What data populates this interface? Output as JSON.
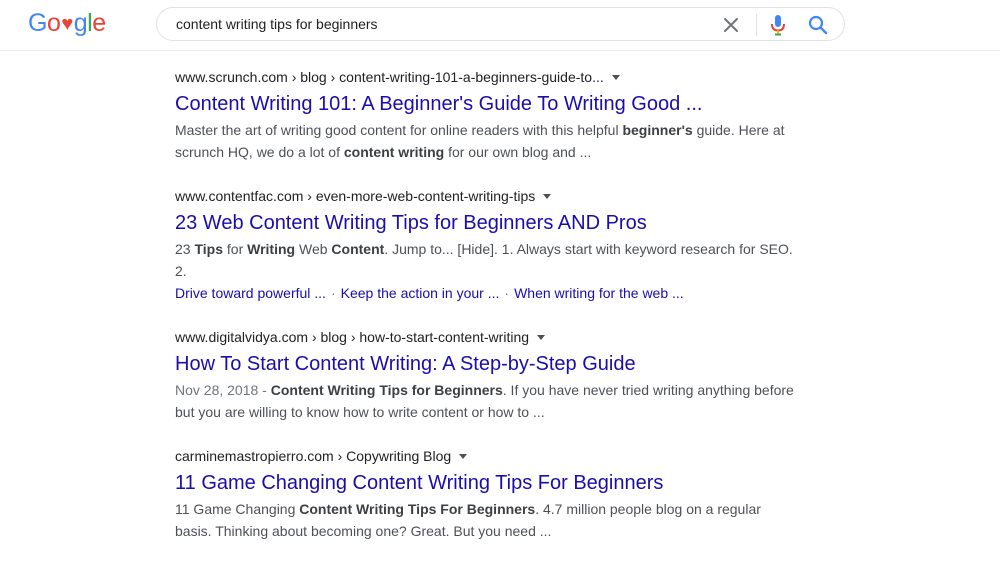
{
  "logo": {
    "letters": [
      {
        "char": "G",
        "color": "#4285F4"
      },
      {
        "char": "o",
        "color": "#EA4335"
      },
      {
        "char": "♥",
        "color": "#EA4335"
      },
      {
        "char": "g",
        "color": "#4285F4"
      },
      {
        "char": "l",
        "color": "#34A853"
      },
      {
        "char": "e",
        "color": "#EA4335"
      }
    ]
  },
  "search": {
    "query": "content writing tips for beginners",
    "icons": [
      "close-icon",
      "microphone-icon",
      "search-icon"
    ]
  },
  "colors": {
    "link": "#1a0dab",
    "snippet": "#4d5156",
    "cite": "#202124",
    "mic_blue": "#4285F4",
    "mic_red": "#EA4335",
    "search_icon": "#4285F4"
  },
  "results": [
    {
      "cite": "www.scrunch.com › blog › content-writing-101-a-beginners-guide-to...",
      "title": "Content Writing 101: A Beginner's Guide To Writing Good ...",
      "snippet_parts": [
        {
          "t": "Master the art of writing good content for online readers with this helpful ",
          "b": false
        },
        {
          "t": "beginner's",
          "b": true
        },
        {
          "t": " guide. Here at scrunch HQ, we do a lot of ",
          "b": false
        },
        {
          "t": "content writing",
          "b": true
        },
        {
          "t": " for our own blog and ...",
          "b": false
        }
      ],
      "sitelinks": []
    },
    {
      "cite": "www.contentfac.com › even-more-web-content-writing-tips",
      "title": "23 Web Content Writing Tips for Beginners AND Pros",
      "snippet_parts": [
        {
          "t": "23 ",
          "b": false
        },
        {
          "t": "Tips",
          "b": true
        },
        {
          "t": " for ",
          "b": false
        },
        {
          "t": "Writing",
          "b": true
        },
        {
          "t": " Web ",
          "b": false
        },
        {
          "t": "Content",
          "b": true
        },
        {
          "t": ". Jump to... [Hide]. 1. Always start with keyword research for SEO. 2.",
          "b": false
        }
      ],
      "sitelinks": [
        "Drive toward powerful ...",
        "Keep the action in your ...",
        "When writing for the web ..."
      ]
    },
    {
      "cite": "www.digitalvidya.com › blog › how-to-start-content-writing",
      "title": "How To Start Content Writing: A Step-by-Step Guide",
      "date": "Nov 28, 2018 - ",
      "snippet_parts": [
        {
          "t": "Content Writing Tips for Beginners",
          "b": true
        },
        {
          "t": ". If you have never tried writing anything before but you are willing to know how to write content or how to ...",
          "b": false
        }
      ],
      "sitelinks": []
    },
    {
      "cite": "carminemastropierro.com › Copywriting Blog",
      "title": "11 Game Changing Content Writing Tips For Beginners",
      "snippet_parts": [
        {
          "t": "11 Game Changing ",
          "b": false
        },
        {
          "t": "Content Writing Tips For Beginners",
          "b": true
        },
        {
          "t": ". 4.7 million people blog on a regular basis. Thinking about becoming one? Great. But you need ...",
          "b": false
        }
      ],
      "sitelinks": []
    }
  ]
}
